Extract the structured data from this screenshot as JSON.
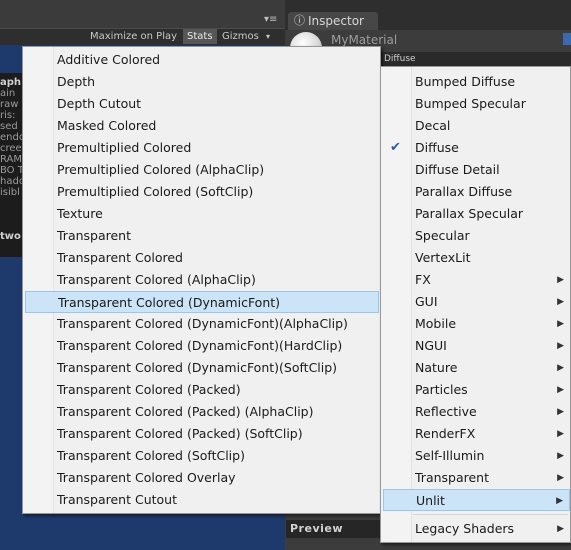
{
  "gameview": {
    "toolbar": {
      "maximize_label": "Maximize on Play",
      "stats_label": "Stats",
      "gizmos_label": "Gizmos",
      "gizmos_arrow": "▾",
      "menu_glyph": "▾≡"
    },
    "stats": [
      {
        "text": "aph",
        "bold": true
      },
      {
        "text": "ain"
      },
      {
        "text": "raw"
      },
      {
        "text": "ris:"
      },
      {
        "text": "sed"
      },
      {
        "text": "endo"
      },
      {
        "text": "cree"
      },
      {
        "text": "RAM"
      },
      {
        "text": "BO T"
      },
      {
        "text": "hado"
      },
      {
        "text": "isibl"
      },
      {
        "text": "two",
        "bold": true
      }
    ]
  },
  "inspector": {
    "tab_icon": "info-icon",
    "tab_label": "Inspector",
    "material_name": "MyMaterial",
    "shader_header": "Diffuse",
    "preview_label": "Preview"
  },
  "shader_submenu": {
    "items": [
      "Additive Colored",
      "Depth",
      "Depth Cutout",
      "Masked Colored",
      "Premultiplied Colored",
      "Premultiplied Colored (AlphaClip)",
      "Premultiplied Colored (SoftClip)",
      "Texture",
      "Transparent",
      "Transparent Colored",
      "Transparent Colored (AlphaClip)",
      "Transparent Colored (DynamicFont)",
      "Transparent Colored (DynamicFont)(AlphaClip)",
      "Transparent Colored (DynamicFont)(HardClip)",
      "Transparent Colored (DynamicFont)(SoftClip)",
      "Transparent Colored (Packed)",
      "Transparent Colored (Packed) (AlphaClip)",
      "Transparent Colored (Packed) (SoftClip)",
      "Transparent Colored (SoftClip)",
      "Transparent Colored Overlay",
      "Transparent Cutout"
    ],
    "highlighted": "Transparent Colored (DynamicFont)"
  },
  "shader_menu": {
    "items": [
      {
        "label": "Bumped Diffuse",
        "submenu": false
      },
      {
        "label": "Bumped Specular",
        "submenu": false
      },
      {
        "label": "Decal",
        "submenu": false
      },
      {
        "label": "Diffuse",
        "submenu": false,
        "checked": true
      },
      {
        "label": "Diffuse Detail",
        "submenu": false
      },
      {
        "label": "Parallax Diffuse",
        "submenu": false
      },
      {
        "label": "Parallax Specular",
        "submenu": false
      },
      {
        "label": "Specular",
        "submenu": false
      },
      {
        "label": "VertexLit",
        "submenu": false
      },
      {
        "label": "FX",
        "submenu": true
      },
      {
        "label": "GUI",
        "submenu": true
      },
      {
        "label": "Mobile",
        "submenu": true
      },
      {
        "label": "NGUI",
        "submenu": true
      },
      {
        "label": "Nature",
        "submenu": true
      },
      {
        "label": "Particles",
        "submenu": true
      },
      {
        "label": "Reflective",
        "submenu": true
      },
      {
        "label": "RenderFX",
        "submenu": true
      },
      {
        "label": "Self-Illumin",
        "submenu": true
      },
      {
        "label": "Transparent",
        "submenu": true
      },
      {
        "label": "Unlit",
        "submenu": true,
        "highlighted": true
      },
      {
        "label": "Legacy Shaders",
        "submenu": true,
        "separator_before": true
      }
    ],
    "checkmark": "✔",
    "submenu_arrow": "▶"
  },
  "colors": {
    "menu_bg": "#f0f0f0",
    "highlight_bg": "#cce4f7",
    "highlight_border": "#99c6ee",
    "gameview_bg": "#1e3a6c",
    "editor_bg": "#383838"
  }
}
